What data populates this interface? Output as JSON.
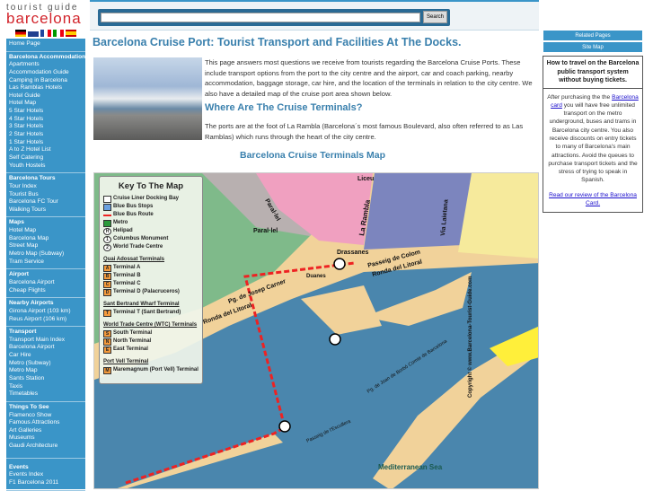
{
  "logo": {
    "line1": "tourist guide",
    "line2": "barcelona"
  },
  "flags": [
    "german-flag",
    "uk-flag",
    "french-flag",
    "italian-flag",
    "spanish-flag"
  ],
  "search": {
    "placeholder": "",
    "button": "Search"
  },
  "sidebar": [
    {
      "heading": "",
      "items": [
        "Home Page"
      ]
    },
    {
      "heading": "Barcelona Accommodation",
      "items": [
        "Apartments",
        "Accommodation Guide",
        "Camping in Barcelona",
        "Las Ramblas Hotels",
        "Hotel Guide",
        "Hotel Map",
        "5 Star Hotels",
        "4 Star Hotels",
        "3 Star Hotels",
        "2 Star Hotels",
        "1 Star Hotels",
        "A to Z Hotel List",
        "Self Catering",
        "Youth Hostels"
      ]
    },
    {
      "heading": "Barcelona Tours",
      "items": [
        "Tour Index",
        "Tourist Bus",
        "Barcelona FC Tour",
        "Walking Tours"
      ]
    },
    {
      "heading": "Maps",
      "items": [
        "Hotel Map",
        "Barcelona Map",
        "Street Map",
        "Metro Map (Subway)",
        "Tram Service"
      ]
    },
    {
      "heading": "Airport",
      "items": [
        "Barcelona Airport",
        "Cheap Flights"
      ]
    },
    {
      "heading": "Nearby Airports",
      "items": [
        "Girona Airport (103 km)",
        "Reus Airport (106 km)"
      ]
    },
    {
      "heading": "Transport",
      "items": [
        "Transport Main Index",
        "Barcelona Airport",
        "Car Hire",
        "Metro (Subway)",
        "Metro Map",
        "Sants Station",
        "Taxis",
        "Timetables"
      ]
    },
    {
      "heading": "Things To See",
      "items": [
        "Flamenco Show",
        "Famous Attractions",
        "Art Galleries",
        "Museums",
        "Gaudi Architecture"
      ]
    },
    {
      "heading": "Events",
      "items": [
        "Events Index",
        "F1 Barcelona 2011"
      ]
    }
  ],
  "main": {
    "title": "Barcelona Cruise Port: Tourist Transport and Facilities At The Docks.",
    "intro": "This page answers most questions we receive from tourists regarding the Barcelona Cruise Ports. These include transport options from the port to the city centre and the airport, car and coach parking, nearby accommodation, baggage storage, car hire, and the location of the terminals in relation to the city centre. We also have a detailed map of the cruise port area shown below.",
    "h2": "Where Are The Cruise Terminals?",
    "para2": "The ports are at the foot of La Rambla (Barcelona´s most famous Boulevard, also often referred to as Las Ramblas) which runs through the heart of the city centre.",
    "map_title": "Barcelona Cruise Terminals Map"
  },
  "key": {
    "title": "Key To The Map",
    "legend": [
      "Cruise Liner Docking Bay",
      "Blue Bus Stops",
      "Blue Bus Route",
      "Metro",
      "Helipad",
      "Columbus Monument",
      "World Trade Centre"
    ],
    "sections": [
      {
        "title": "Quai Adossat Terminals",
        "items": [
          [
            "A",
            "Terminal A"
          ],
          [
            "B",
            "Terminal B"
          ],
          [
            "C",
            "Terminal C"
          ],
          [
            "D",
            "Terminal D (Palacruceros)"
          ]
        ]
      },
      {
        "title": "Sant Bertrand Wharf Terminal",
        "items": [
          [
            "T",
            "Terminal T (Sant Bertrand)"
          ]
        ]
      },
      {
        "title": "World Trade Centre (WTC) Terminals",
        "items": [
          [
            "S",
            "South Terminal"
          ],
          [
            "N",
            "North Terminal"
          ],
          [
            "E",
            "East Terminal"
          ]
        ]
      },
      {
        "title": "Port Vell Terminal",
        "items": [
          [
            "M",
            "Maremagnum (Port Vell) Terminal"
          ]
        ]
      }
    ]
  },
  "map_labels": {
    "liceu": "Liceu",
    "parallel_st": "Paral·lel",
    "parallel_stn": "Paral·lel",
    "rambla": "La Rambla",
    "laietana": "Via Laietana",
    "drassanes": "Drassanes",
    "colom": "Passeig de Colom",
    "litoral1": "Ronda del Litoral",
    "litoral2": "Ronda del Litoral",
    "carner": "Pg. de Josep Carner",
    "duanes": "Duanes",
    "borbo": "Pg. de Joan de Borbó Comte de Barcelona",
    "escullera": "Passeig de l'Escullera",
    "sea": "Mediterranean Sea",
    "copyright": "Copyright © www.Barcelona-Tourist-Guide.com"
  },
  "right": {
    "links": [
      "Related Pages",
      "Site Map"
    ],
    "tip_heading": "How to travel on the Barcelona public transport system without buying tickets.",
    "tip_pre": "After purchasing the the ",
    "tip_link": "Barcelona card",
    "tip_post": " you will have free unlimited transport on the metro underground, buses and trams in Barcelona city centre. You also receive discounts on entry tickets to many of Barcelona's main attractions. Avoid the queues to purchase transport tickets and the stress of trying to speak in Spanish.",
    "review_link": "Read our review of the Barcelona Card."
  },
  "colors": {
    "accent": "#3a95c8",
    "title": "#3a80ad",
    "sea": "#4a86ad",
    "land": "#f1d29a"
  }
}
